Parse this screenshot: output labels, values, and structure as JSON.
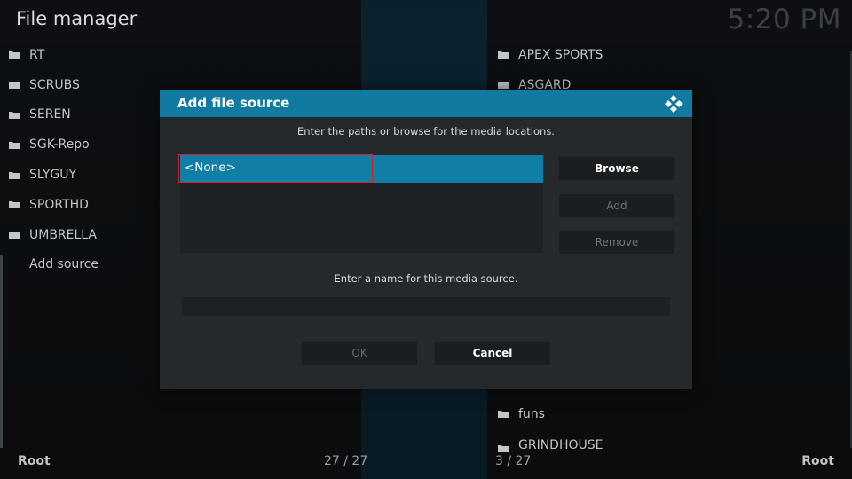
{
  "app": {
    "title": "File manager",
    "clock": "5:20 PM"
  },
  "left_list": {
    "items": [
      {
        "label": "RT",
        "icon": "folder-icon"
      },
      {
        "label": "SCRUBS",
        "icon": "folder-icon"
      },
      {
        "label": "SEREN",
        "icon": "folder-icon"
      },
      {
        "label": "SGK-Repo",
        "icon": "folder-icon"
      },
      {
        "label": "SLYGUY",
        "icon": "folder-icon"
      },
      {
        "label": "SPORTHD",
        "icon": "folder-icon"
      },
      {
        "label": "UMBRELLA",
        "icon": "folder-icon"
      },
      {
        "label": "Add source",
        "icon": ""
      }
    ]
  },
  "right_list": {
    "items_top": [
      {
        "label": "APEX SPORTS",
        "icon": "folder-icon"
      },
      {
        "label": "ASGARD",
        "icon": "folder-icon"
      }
    ],
    "items_bottom": [
      {
        "label": "funs",
        "icon": "folder-icon"
      },
      {
        "label": "GRINDHOUSE",
        "icon": "folder-icon"
      }
    ]
  },
  "footer": {
    "left_location": "Root",
    "left_count": "27 / 27",
    "right_count": "3 / 27",
    "right_location": "Root"
  },
  "dialog": {
    "title": "Add file source",
    "paths_hint": "Enter the paths or browse for the media locations.",
    "path_entry": "<None>",
    "browse_label": "Browse",
    "add_label": "Add",
    "remove_label": "Remove",
    "name_hint": "Enter a name for this media source.",
    "name_value": "",
    "ok_label": "OK",
    "cancel_label": "Cancel"
  },
  "colors": {
    "accent": "#117aa0",
    "selection": "#0f7fa8",
    "highlight_border": "#d6202a",
    "dialog_bg": "#25292c",
    "background": "#0f1215"
  }
}
